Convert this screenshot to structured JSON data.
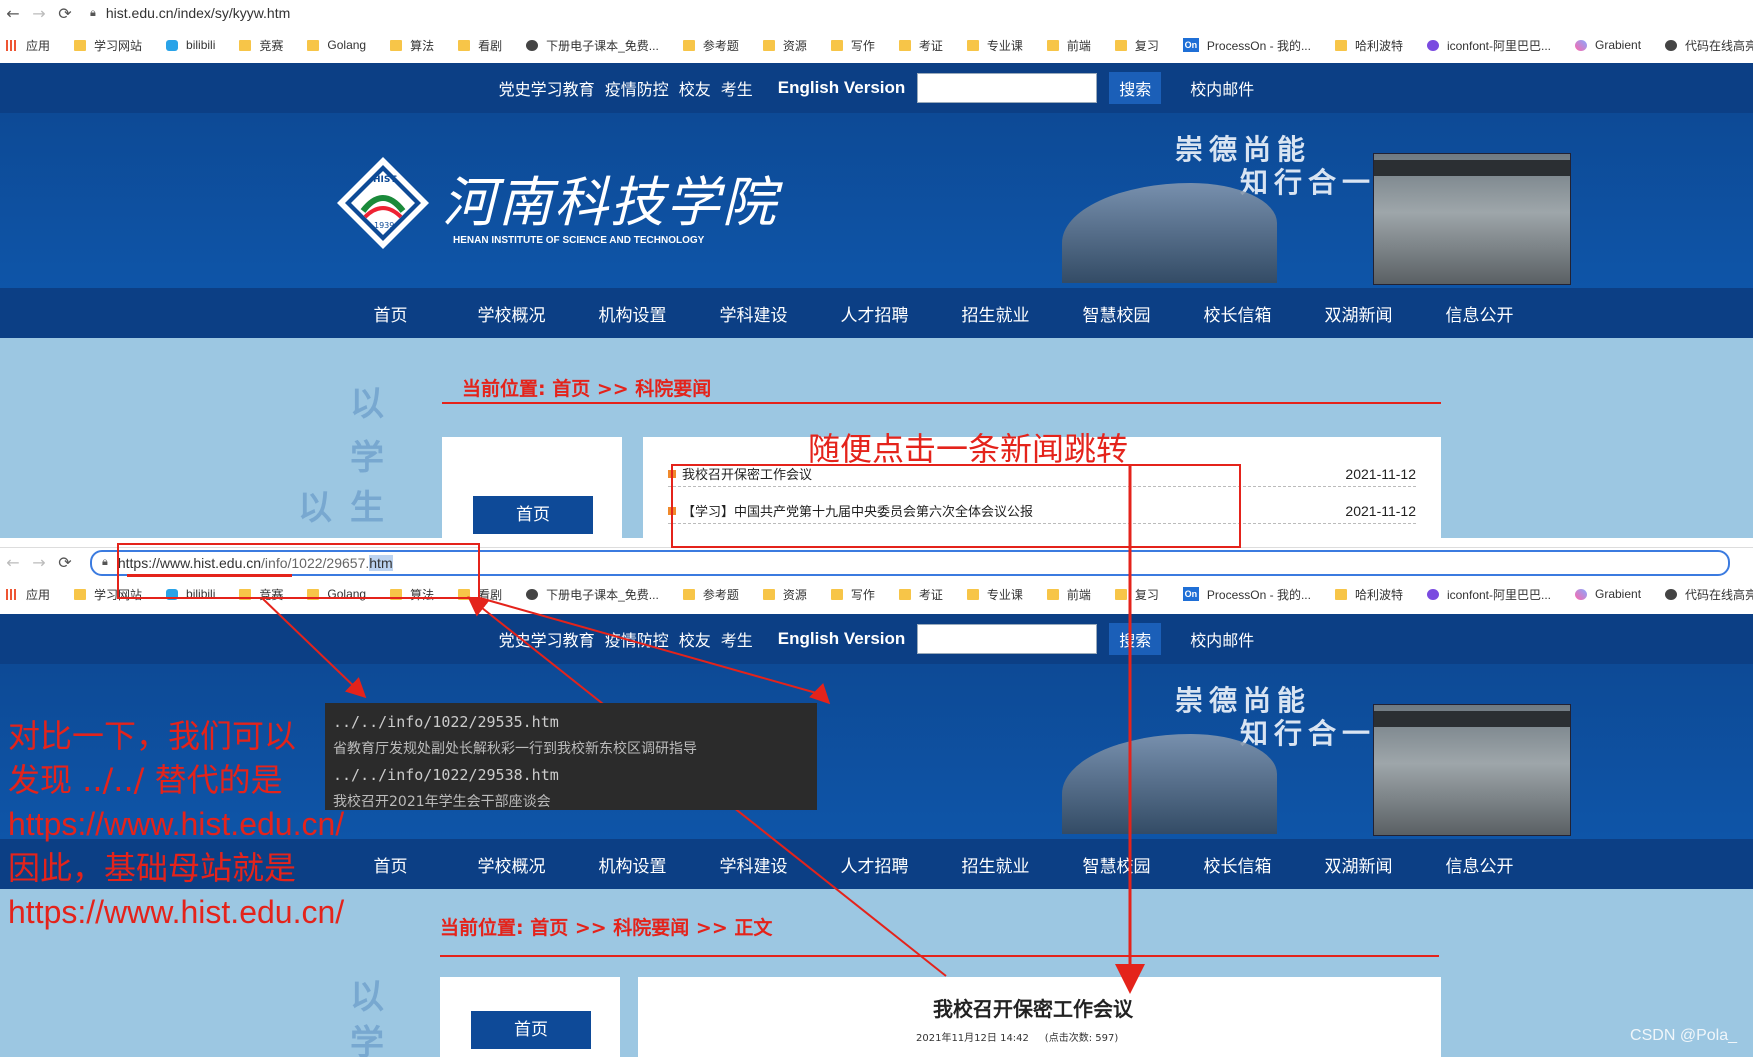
{
  "browser1": {
    "url": "hist.edu.cn/index/sy/kyyw.htm"
  },
  "browser2": {
    "url_prefix": "https://www.hist.edu.cn",
    "url_path": "/info/1022/29657.",
    "url_ext": "htm"
  },
  "bookmarks": [
    "应用",
    "学习网站",
    "bilibili",
    "竞赛",
    "Golang",
    "算法",
    "看剧",
    "下册电子课本_免费...",
    "参考题",
    "资源",
    "写作",
    "考证",
    "专业课",
    "前端",
    "复习",
    "ProcessOn - 我的...",
    "哈利波特",
    "iconfont-阿里巴巴...",
    "Grabient",
    "代码在线高亮工具 |..."
  ],
  "bookmark_icons": [
    "grid",
    "folder",
    "tv",
    "folder",
    "folder",
    "folder",
    "folder",
    "round3",
    "folder",
    "folder",
    "folder",
    "folder",
    "folder",
    "folder",
    "folder",
    "on",
    "folder",
    "round",
    "round2",
    "round3"
  ],
  "topbar": {
    "links": [
      "党史学习教育",
      "疫情防控",
      "校友",
      "考生"
    ],
    "english": "English Version",
    "search_btn": "搜索",
    "mail": "校内邮件"
  },
  "banner": {
    "name": "河南科技学院",
    "sub": "HENAN INSTITUTE OF SCIENCE AND TECHNOLOGY",
    "motto1": "崇德尚能",
    "motto2": "知行合一",
    "logo_text": "HIST",
    "logo_year": "1939"
  },
  "menu": [
    "首页",
    "学校概况",
    "机构设置",
    "学科建设",
    "人才招聘",
    "招生就业",
    "智慧校园",
    "校长信箱",
    "双湖新闻",
    "信息公开"
  ],
  "page1": {
    "crumb": "当前位置: 首页 >> 科院要闻",
    "home_btn": "首页",
    "side_chars": [
      "以",
      "学",
      "以",
      "生"
    ],
    "news": [
      {
        "title": "我校召开保密工作会议",
        "date": "2021-11-12"
      },
      {
        "title": "【学习】中国共产党第十九届中央委员会第六次全体会议公报",
        "date": "2021-11-12"
      }
    ]
  },
  "page2": {
    "crumb": "当前位置: 首页 >> 科院要闻 >> 正文",
    "home_btn": "首页",
    "side_chars": [
      "以",
      "学"
    ],
    "article_title": "我校召开保密工作会议",
    "article_meta": "2021年11月12日 14:42     (点击次数: 597)"
  },
  "annotations": {
    "click_note": "随便点击一条新闻跳转",
    "compare_lines": [
      "对比一下，我们可以",
      "发现 ../../ 替代的是",
      "https://www.hist.edu.cn/",
      "因此，基础母站就是",
      "https://www.hist.edu.cn/"
    ],
    "code_lines": [
      "../../info/1022/29535.htm",
      "省教育厅发规处副处长解秋彩一行到我校新东校区调研指导",
      "../../info/1022/29538.htm",
      "我校召开2021年学生会干部座谈会"
    ]
  },
  "watermark": "CSDN @Pola_",
  "colors": {
    "navy": "#0c3f85",
    "banner": "#0e55a8",
    "accent_red": "#e4231b",
    "page_bg": "#9cc7e2"
  }
}
